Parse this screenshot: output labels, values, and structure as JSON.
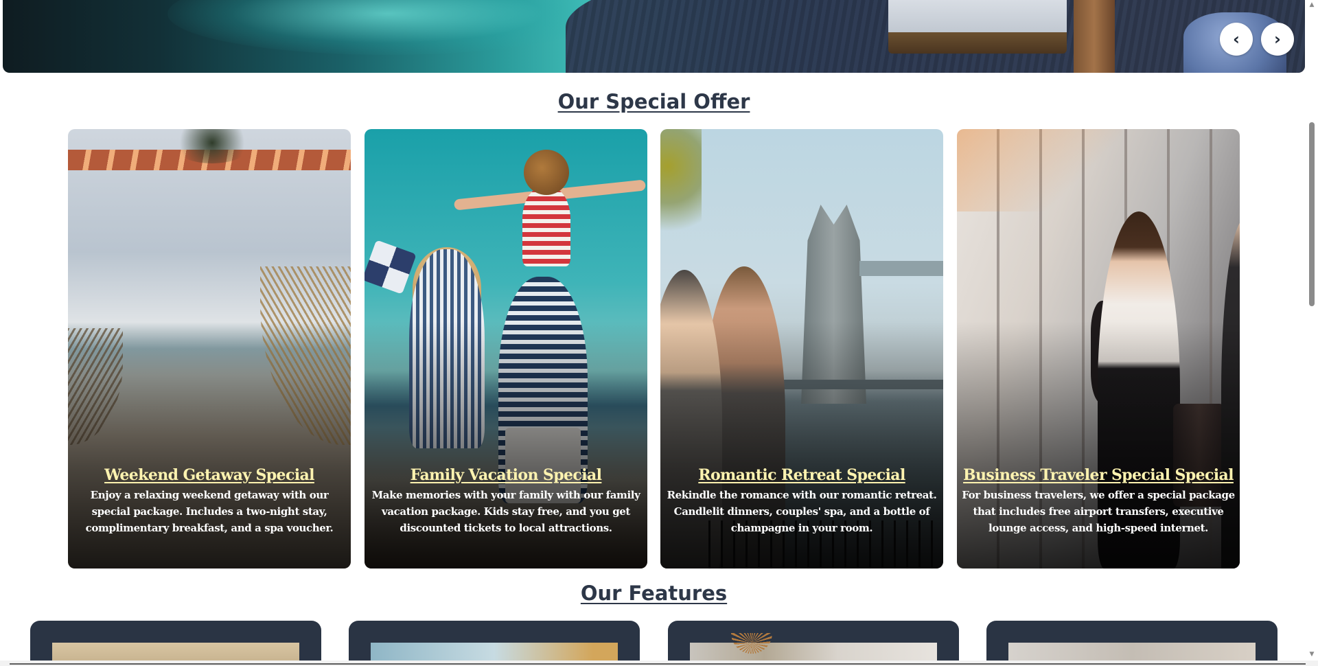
{
  "carousel": {
    "prev_label": "‹",
    "next_label": "›"
  },
  "offers": {
    "title": "Our Special Offer",
    "items": [
      {
        "title": "Weekend Getaway Special",
        "description": "Enjoy a relaxing weekend getaway with our special package. Includes a two-night stay, complimentary breakfast, and a spa voucher."
      },
      {
        "title": "Family Vacation Special",
        "description": "Make memories with your family with our family vacation package. Kids stay free, and you get discounted tickets to local attractions."
      },
      {
        "title": "Romantic Retreat Special",
        "description": "Rekindle the romance with our romantic retreat. Candlelit dinners, couples' spa, and a bottle of champagne in your room."
      },
      {
        "title": "Business Traveler Special Special",
        "description": "For business travelers, we offer a special package that includes free airport transfers, executive lounge access, and high-speed internet."
      }
    ]
  },
  "features": {
    "title": "Our Features"
  },
  "colors": {
    "heading": "#2d3748",
    "offer_title": "#fef3b0",
    "feature_card": "#2a3444"
  }
}
